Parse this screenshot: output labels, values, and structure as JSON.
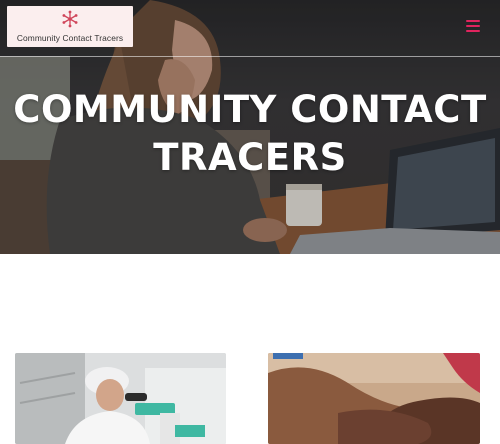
{
  "header": {
    "logo_text": "Community Contact Tracers",
    "logo_icon": "snowflake-network-icon",
    "menu_icon": "hamburger-menu-icon",
    "accent_color": "#e0245e"
  },
  "hero": {
    "title_line1": "COMMUNITY CONTACT",
    "title_line2": "TRACERS"
  },
  "cards": [
    {
      "image": "lab-scientist-microscope-photo"
    },
    {
      "image": "holding-hands-photo"
    }
  ]
}
